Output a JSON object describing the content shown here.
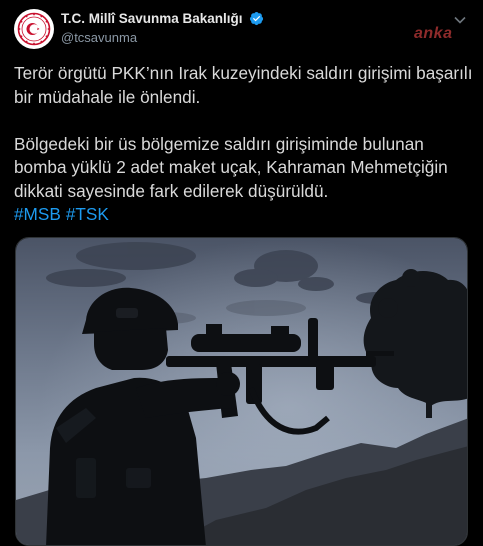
{
  "account": {
    "name": "T.C. Millî Savunma Bakanlığı",
    "handle": "@tcsavunma",
    "verified_icon": "verified-badge-icon",
    "avatar_icon": "ministry-seal-icon"
  },
  "watermark": "anka",
  "tweet": {
    "paragraph1": "Terör örgütü PKK’nın Irak kuzeyindeki saldırı girişimi başarılı bir müdahale ile önlendi.",
    "paragraph2": "Bölgedeki bir üs bölgemize saldırı girişiminde bulunan bomba yüklü 2 adet maket uçak, Kahraman Mehmetçiğin dikkati sayesinde fark edilerek düşürüldü.",
    "hashtags": [
      "#MSB",
      "#TSK"
    ]
  },
  "colors": {
    "background": "#000000",
    "text": "#d9d9d9",
    "secondary": "#8b98a5",
    "link": "#1d9bf0",
    "verified": "#1d9bf0",
    "seal_red": "#c8102e"
  },
  "media": {
    "icon": "soldier-silhouette-photo"
  }
}
